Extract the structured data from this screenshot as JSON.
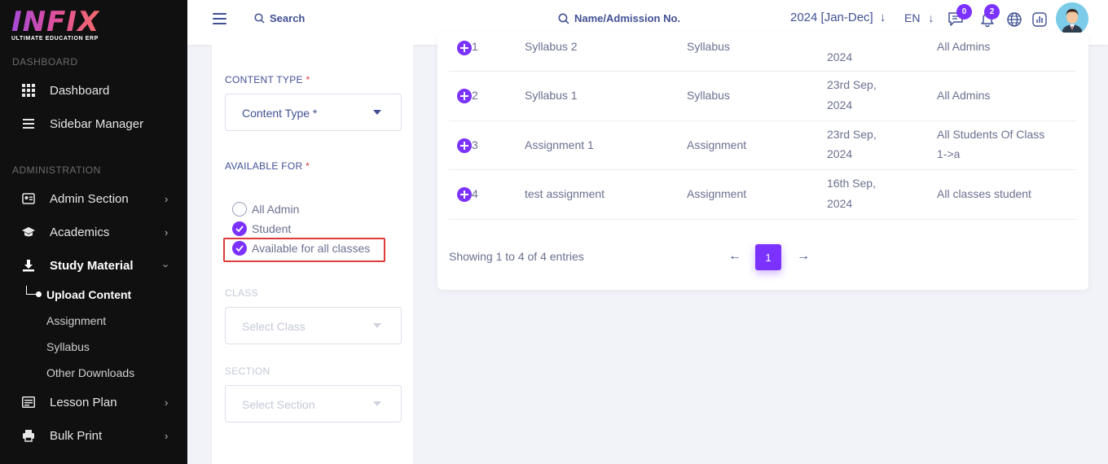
{
  "brand": {
    "name": "INFIX",
    "tagline": "ULTIMATE EDUCATION ERP"
  },
  "sidebar": {
    "section_dashboard": "DASHBOARD",
    "section_admin": "ADMINISTRATION",
    "items": [
      {
        "label": "Dashboard",
        "icon": "grid-icon"
      },
      {
        "label": "Sidebar Manager",
        "icon": "menu-icon"
      },
      {
        "label": "Admin Section",
        "icon": "id-card-icon"
      },
      {
        "label": "Academics",
        "icon": "graduation-cap-icon"
      },
      {
        "label": "Study Material",
        "icon": "download-icon"
      },
      {
        "label": "Lesson Plan",
        "icon": "list-icon"
      },
      {
        "label": "Bulk Print",
        "icon": "printer-icon"
      }
    ],
    "subitems": [
      "Upload Content",
      "Assignment",
      "Syllabus",
      "Other Downloads"
    ]
  },
  "header": {
    "search_label": "Search",
    "admission_label": "Name/Admission No.",
    "year": "2024 [Jan-Dec]",
    "language": "EN",
    "messages_count": "0",
    "notifications_count": "2"
  },
  "form": {
    "content_type_label": "CONTENT TYPE",
    "required_mark": "*",
    "content_type_value": "Content Type *",
    "available_for_label": "AVAILABLE FOR",
    "options": [
      "All Admin",
      "Student",
      "Available for all classes"
    ],
    "class_label": "CLASS",
    "class_placeholder": "Select Class",
    "section_label": "SECTION",
    "section_placeholder": "Select Section"
  },
  "table": {
    "rows": [
      {
        "sl": "1",
        "title": "Syllabus 2",
        "type": "Syllabus",
        "date_line1": "",
        "date_line2": "2024",
        "available_line1": "All Admins",
        "available_line2": ""
      },
      {
        "sl": "2",
        "title": "Syllabus 1",
        "type": "Syllabus",
        "date_line1": "23rd Sep,",
        "date_line2": "2024",
        "available_line1": "All Admins",
        "available_line2": ""
      },
      {
        "sl": "3",
        "title": "Assignment 1",
        "type": "Assignment",
        "date_line1": "23rd Sep,",
        "date_line2": "2024",
        "available_line1": "All Students Of Class",
        "available_line2": "1->a"
      },
      {
        "sl": "4",
        "title": "test assignment",
        "type": "Assignment",
        "date_line1": "16th Sep,",
        "date_line2": "2024",
        "available_line1": "All classes student",
        "available_line2": ""
      }
    ],
    "info": "Showing 1 to 4 of 4 entries",
    "prev": "←",
    "page": "1",
    "next": "→"
  }
}
